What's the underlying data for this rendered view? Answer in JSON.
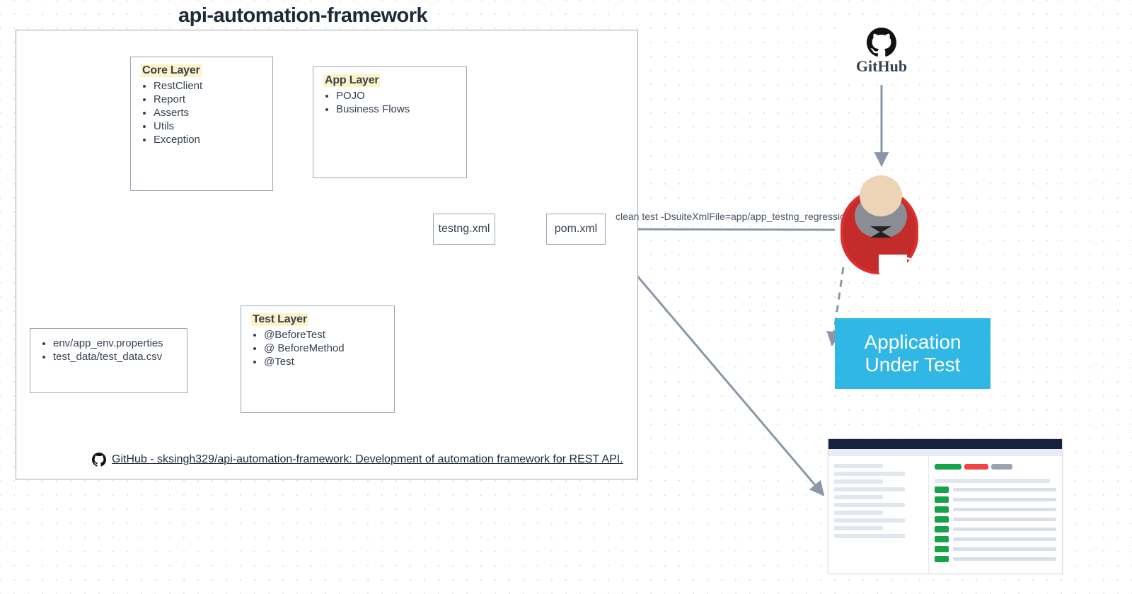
{
  "framework": {
    "title": "api-automation-framework",
    "core": {
      "title": "Core Layer",
      "items": [
        "RestClient",
        "Report",
        "Asserts",
        "Utils",
        "Exception"
      ]
    },
    "app": {
      "title": "App Layer",
      "items": [
        "POJO",
        "Business Flows"
      ]
    },
    "test": {
      "title": "Test Layer",
      "items": [
        "@BeforeTest",
        "@ BeforeMethod",
        "@Test"
      ]
    },
    "resources": {
      "items": [
        "env/app_env.properties",
        "test_data/test_data.csv"
      ]
    },
    "testng": "testng.xml",
    "pom": "pom.xml",
    "repo_text": "GitHub - sksingh329/api-automation-framework: Development of automation framework for REST API."
  },
  "external": {
    "github_label": "GitHub",
    "jenkins_cmd": "clean test -DsuiteXmlFile=app/app_testng_regression.xml",
    "aut_label": "Application Under Test"
  }
}
